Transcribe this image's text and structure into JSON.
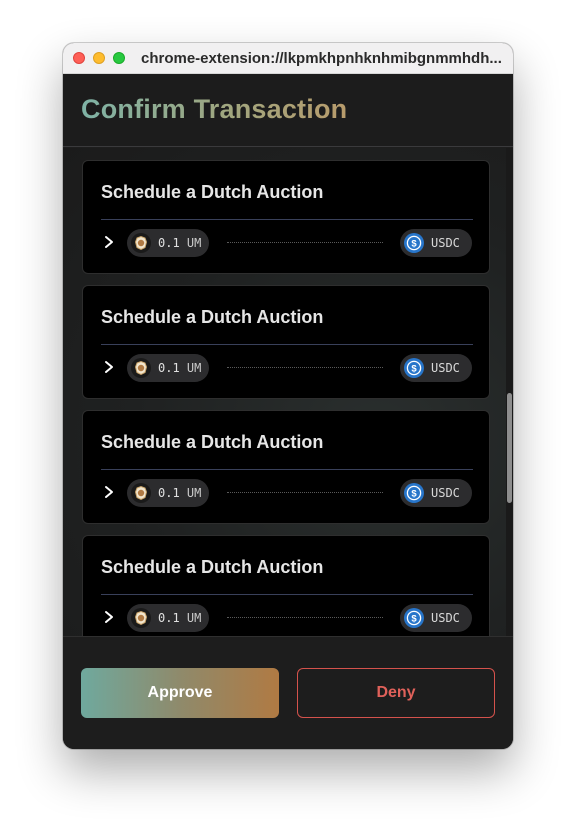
{
  "window": {
    "url": "chrome-extension://lkpmkhpnhknhmibgnmmhdh..."
  },
  "header": {
    "title": "Confirm Transaction"
  },
  "actions": [
    {
      "title": "Schedule a Dutch Auction",
      "input_amount": "0.1",
      "input_asset": "UM",
      "output_asset": "USDC"
    },
    {
      "title": "Schedule a Dutch Auction",
      "input_amount": "0.1",
      "input_asset": "UM",
      "output_asset": "USDC"
    },
    {
      "title": "Schedule a Dutch Auction",
      "input_amount": "0.1",
      "input_asset": "UM",
      "output_asset": "USDC"
    },
    {
      "title": "Schedule a Dutch Auction",
      "input_amount": "0.1",
      "input_asset": "UM",
      "output_asset": "USDC"
    }
  ],
  "icons": {
    "expand": "chevron-right-icon",
    "input_asset": "penumbra-um-icon",
    "output_asset": "usdc-icon"
  },
  "footer": {
    "approve_label": "Approve",
    "deny_label": "Deny"
  },
  "colors": {
    "approve_gradient_start": "#6fa99e",
    "approve_gradient_end": "#b07a43",
    "deny": "#e0615a",
    "card_background": "#000000"
  }
}
